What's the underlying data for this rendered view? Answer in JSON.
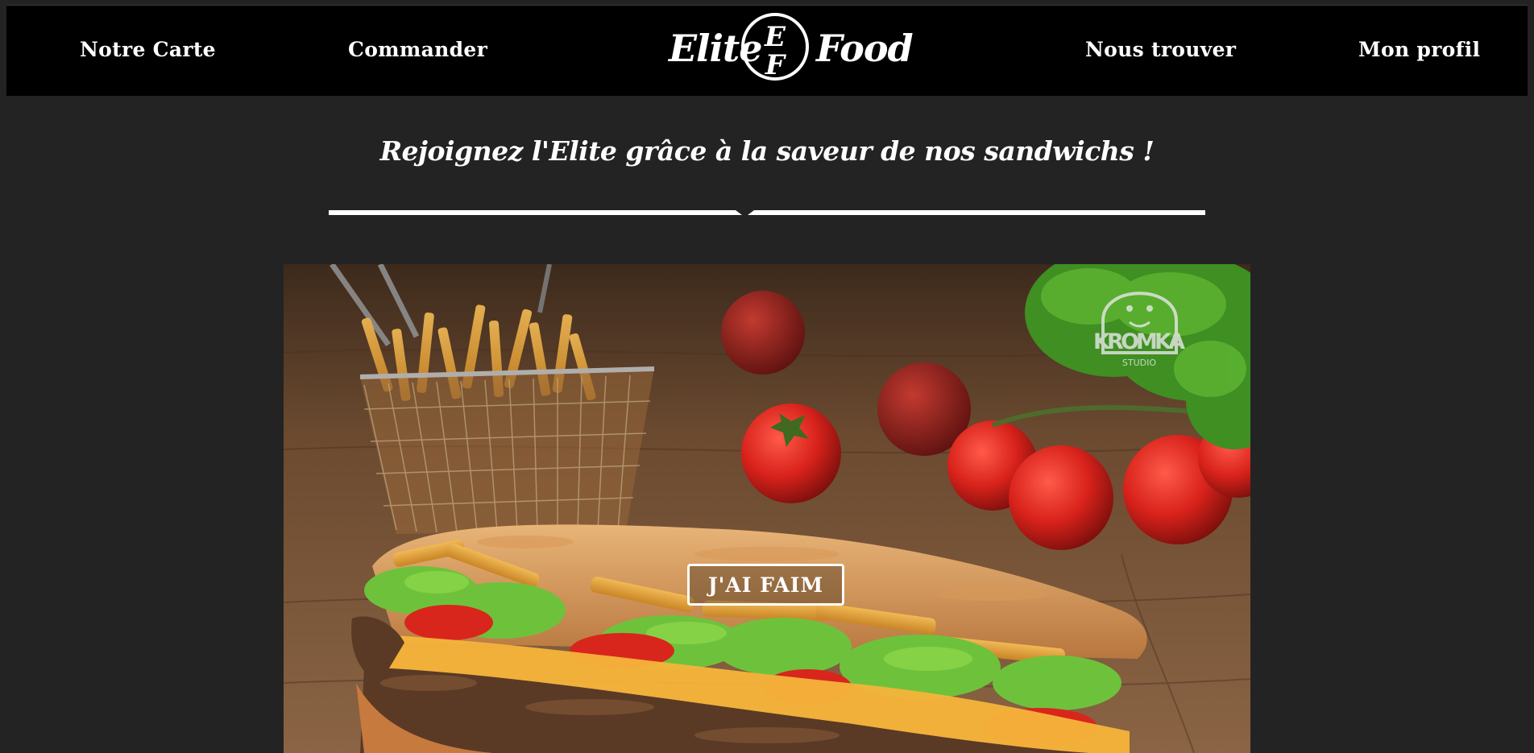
{
  "nav": {
    "items": [
      {
        "label": "Notre Carte"
      },
      {
        "label": "Commander"
      },
      {
        "label": "Nous trouver"
      },
      {
        "label": "Mon profil"
      }
    ]
  },
  "logo": {
    "left_word": "Elite",
    "right_word": "Food",
    "monogram_top": "E",
    "monogram_bottom": "F"
  },
  "hero": {
    "tagline": "Rejoignez l'Elite grâce à la saveur de nos sandwichs !",
    "cta_label": "J'AI FAIM",
    "watermark_text": "KROMKA",
    "watermark_subtext": "STUDIO"
  },
  "colors": {
    "page_background": "#232323",
    "navbar_background": "#000000",
    "text": "#ffffff"
  }
}
